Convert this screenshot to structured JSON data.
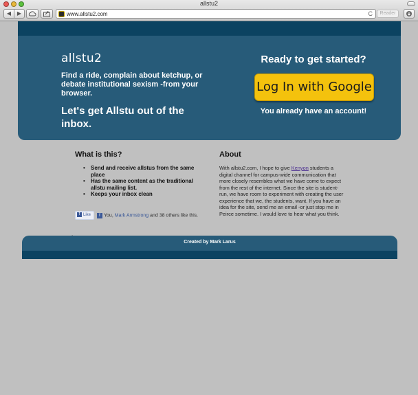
{
  "browser": {
    "window_title": "allstu2",
    "url": "www.allstu2.com",
    "reader_label": "Reader",
    "back_glyph": "◀",
    "forward_glyph": "▶",
    "reload_glyph": "C"
  },
  "hero": {
    "logo": "allstu2",
    "tagline": "Find a ride, complain about ketchup, or debate institutional sexism -from your browser.",
    "cta_heading": "Let's get Allstu out of the inbox.",
    "ready_heading": "Ready to get started?",
    "login_button": "Log In with Google",
    "already_account": "You already have an account!"
  },
  "what": {
    "title": "What is this?",
    "features": [
      "Send and receive allstus from the same place",
      "Has the same content as the traditional allstu mailing list.",
      "Keeps your inbox clean"
    ]
  },
  "like": {
    "button_label": "Like",
    "prefix": "You,",
    "friend_name": "Mark Armstrong",
    "suffix": "and 38 others like this."
  },
  "about": {
    "title": "About",
    "text_before_link": "With allstu2.com, I hope to give ",
    "link_text": "Kenyon",
    "text_after_link": " students a digital channel for campus-wide communication that more closely resembles what we have come to expect from the rest of the internet. Since the site is student-run, we have room to experiment with creating the user experience that we, the students, want. If you have an idea for the site, send me an email -or just stop me in Peirce sometime. I would love to hear what you think."
  },
  "footer": {
    "credit": "Created by Mark Larus"
  },
  "colors": {
    "hero_bg": "#275b79",
    "hero_strip": "#0c4361",
    "google_button": "#f4c20d",
    "page_bg": "#c0c0c0"
  }
}
